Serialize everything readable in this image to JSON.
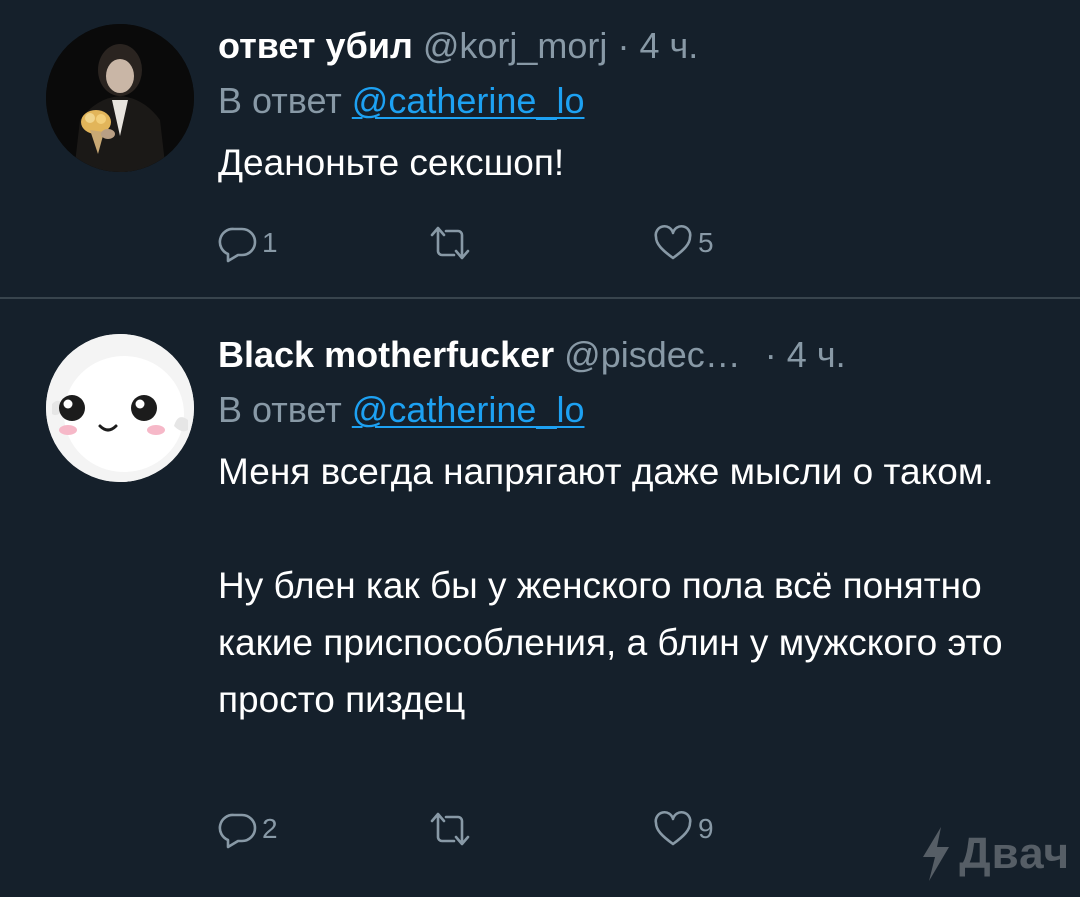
{
  "tweets": [
    {
      "display_name": "ответ убил",
      "handle": "@korj_morj",
      "separator": "·",
      "time": "4 ч.",
      "reply_prefix": "В ответ",
      "reply_to": "@catherine_lo",
      "text": [
        "Деаноньте сексшоп!"
      ],
      "reply_count": "1",
      "retweet_count": "",
      "like_count": "5",
      "avatar_icon": "user-photo-avatar-icon"
    },
    {
      "display_name": "Black motherfucker",
      "handle": "@pisdec…",
      "separator": "·",
      "time": "4 ч.",
      "reply_prefix": "В ответ",
      "reply_to": "@catherine_lo",
      "text": [
        "Меня всегда напрягают даже мысли о таком.",
        "Ну блен как бы у женского пола всё понятно какие приспособления, а блин у мужского это просто пиздец"
      ],
      "reply_count": "2",
      "retweet_count": "",
      "like_count": "9",
      "avatar_icon": "cute-ghost-avatar-icon"
    }
  ],
  "icons": {
    "reply": "reply-bubble-icon",
    "retweet": "retweet-icon",
    "like": "heart-icon"
  },
  "watermark": {
    "text": "Двач",
    "icon": "lightning-bolt-icon"
  },
  "colors": {
    "background": "#15202b",
    "divider": "#38444d",
    "text_primary": "#ffffff",
    "text_secondary": "#8899a6",
    "link": "#1da1f2"
  }
}
